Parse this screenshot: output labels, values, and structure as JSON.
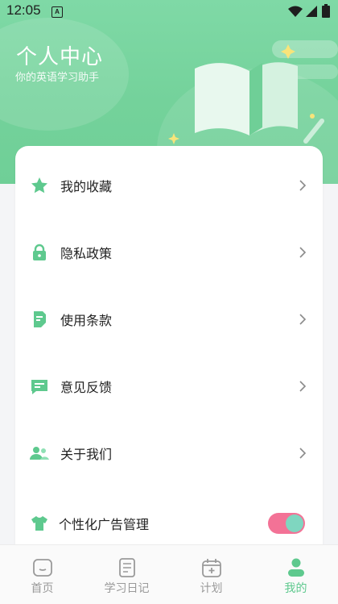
{
  "status": {
    "time": "12:05",
    "notification_badge": "A"
  },
  "header": {
    "title": "个人中心",
    "subtitle": "你的英语学习助手"
  },
  "menu": [
    {
      "label": "我的收藏",
      "icon": "star-icon"
    },
    {
      "label": "隐私政策",
      "icon": "lock-icon"
    },
    {
      "label": "使用条款",
      "icon": "document-icon"
    },
    {
      "label": "意见反馈",
      "icon": "message-icon"
    },
    {
      "label": "关于我们",
      "icon": "users-icon"
    }
  ],
  "ad_setting": {
    "label": "个性化广告管理",
    "icon": "shirt-icon",
    "enabled": true
  },
  "tabs": [
    {
      "label": "首页",
      "icon": "home-icon",
      "active": false
    },
    {
      "label": "学习日记",
      "icon": "diary-icon",
      "active": false
    },
    {
      "label": "计划",
      "icon": "calendar-icon",
      "active": false
    },
    {
      "label": "我的",
      "icon": "profile-icon",
      "active": true
    }
  ],
  "colors": {
    "accent": "#5ec98e",
    "header": "#74d29b",
    "toggle_track": "#f37296",
    "toggle_knob": "#7fd6c0"
  }
}
